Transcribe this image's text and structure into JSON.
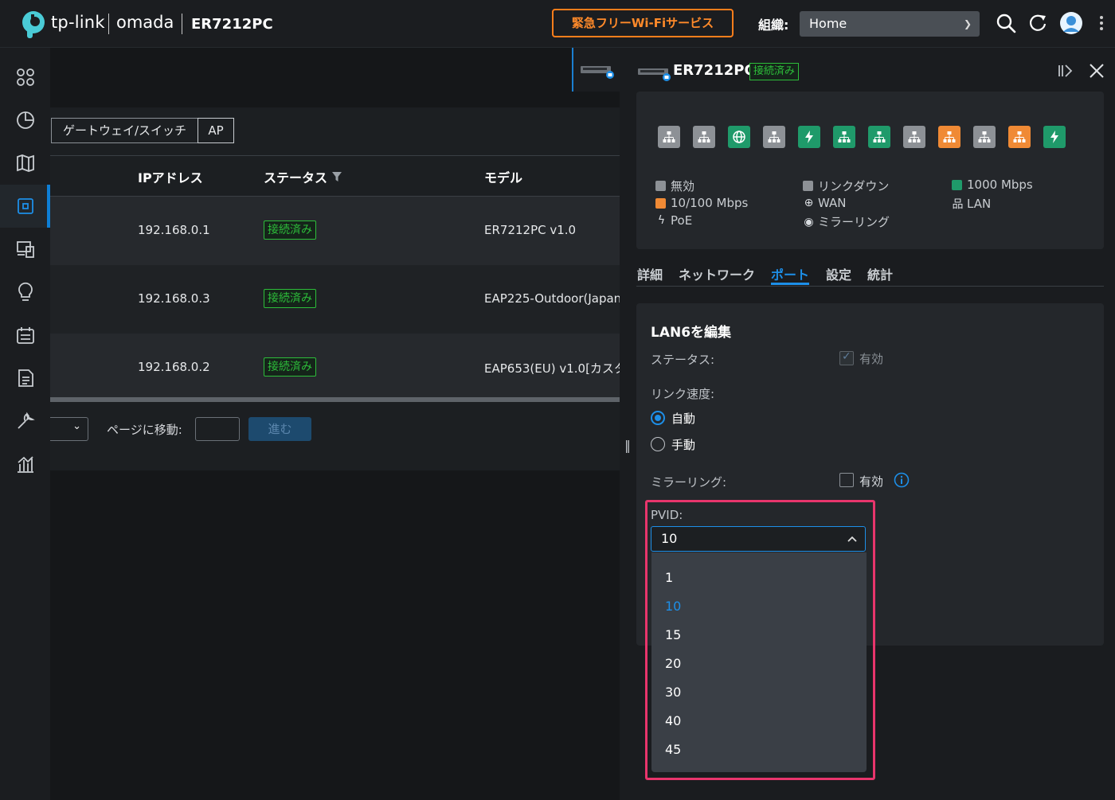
{
  "header": {
    "brand": "tp-link",
    "product": "omada",
    "device_model": "ER7212PC",
    "promo_button": "緊急フリーWi-Fiサービス",
    "org_label": "組織:",
    "org_value": "Home"
  },
  "sidebar": {
    "items": [
      "dashboard-icon",
      "statistics-icon",
      "map-icon",
      "devices-icon",
      "clients-icon",
      "insights-icon",
      "logs-icon",
      "reports-icon",
      "tools-icon",
      "analytics-icon"
    ],
    "active_index": 3
  },
  "device_list": {
    "segments": [
      "ゲートウェイ/スイッチ",
      "AP"
    ],
    "columns": [
      "IPアドレス",
      "ステータス",
      "モデル"
    ],
    "rows": [
      {
        "ip": "192.168.0.1",
        "status": "接続済み",
        "model": "ER7212PC v1.0"
      },
      {
        "ip": "192.168.0.3",
        "status": "接続済み",
        "model": "EAP225-Outdoor(Japan"
      },
      {
        "ip": "192.168.0.2",
        "status": "接続済み",
        "model": "EAP653(EU) v1.0[カスタ"
      }
    ],
    "pager": {
      "goto_label": "ページに移動:",
      "go_button": "進む"
    }
  },
  "panel": {
    "device_name": "ER7212PC",
    "status": "接続済み",
    "ports": [
      "gray",
      "gray",
      "green-wan",
      "gray",
      "green-poe",
      "green",
      "green",
      "gray",
      "orange",
      "gray",
      "orange",
      "green-poe"
    ],
    "legend": {
      "disabled": "無効",
      "link_down": "リンクダウン",
      "gigabit": "1000 Mbps",
      "fast": "10/100 Mbps",
      "wan": "WAN",
      "lan": "LAN",
      "poe": "PoE",
      "mirroring": "ミラーリング"
    },
    "legend_colors": {
      "disabled": "#8d9196",
      "link_down": "#8d9196",
      "gigabit": "#1f9a6a",
      "fast": "#f08a35"
    },
    "tabs": [
      "詳細",
      "ネットワーク",
      "ポート",
      "設定",
      "統計"
    ],
    "active_tab": "ポート",
    "edit": {
      "title": "LAN6を編集",
      "status_label": "ステータス:",
      "status_value": "有効",
      "speed_label": "リンク速度:",
      "speed_auto": "自動",
      "speed_manual": "手動",
      "mirroring_label": "ミラーリング:",
      "mirroring_value": "有効",
      "pvid_label": "PVID:",
      "pvid_value": "10",
      "pvid_options": [
        "1",
        "10",
        "15",
        "20",
        "30",
        "40",
        "45"
      ]
    }
  }
}
